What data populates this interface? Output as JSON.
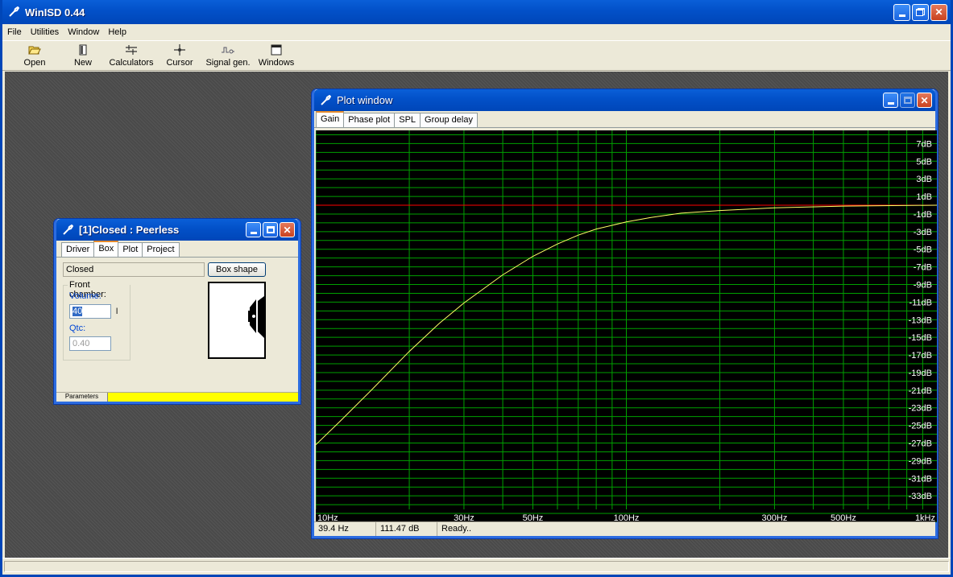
{
  "app": {
    "title": "WinISD 0.44",
    "menu": [
      "File",
      "Utilities",
      "Window",
      "Help"
    ],
    "toolbar": [
      {
        "label": "Open",
        "icon": "open-folder-icon"
      },
      {
        "label": "New",
        "icon": "new-document-icon"
      },
      {
        "label": "Calculators",
        "icon": "calculator-icon"
      },
      {
        "label": "Cursor",
        "icon": "cursor-icon"
      },
      {
        "label": "Signal gen.",
        "icon": "signal-generator-icon"
      },
      {
        "label": "Windows",
        "icon": "windows-icon"
      }
    ]
  },
  "box_window": {
    "title": "[1]Closed : Peerless",
    "tabs": [
      "Driver",
      "Box",
      "Plot",
      "Project"
    ],
    "active_tab": "Box",
    "box_type": "Closed",
    "box_shape_button": "Box shape",
    "front_chamber_label": "Front chamber:",
    "volume_label": "Volume:",
    "volume_value": "40",
    "volume_unit": "l",
    "qtc_label": "Qtc:",
    "qtc_value": "0.40",
    "bottom_tab": "Parameters"
  },
  "plot_window": {
    "title": "Plot window",
    "tabs": [
      "Gain",
      "Phase plot",
      "SPL",
      "Group delay"
    ],
    "active_tab": "Gain",
    "status": {
      "frequency": "39.4 Hz",
      "level": "111.47 dB",
      "message": "Ready.."
    }
  },
  "colors": {
    "curve": "#ffff66",
    "reference_line": "#ff0000",
    "grid": "#00a000",
    "axis_text": "#ffffff",
    "plot_background": "#000000"
  },
  "chart_data": {
    "type": "line",
    "title": "",
    "xlabel": "",
    "ylabel": "",
    "xscale": "log",
    "xlim": [
      10,
      1000
    ],
    "ylim": [
      -35,
      9
    ],
    "x_ticks": [
      {
        "value": 10,
        "label": "10Hz"
      },
      {
        "value": 30,
        "label": "30Hz"
      },
      {
        "value": 50,
        "label": "50Hz"
      },
      {
        "value": 100,
        "label": "100Hz"
      },
      {
        "value": 300,
        "label": "300Hz"
      },
      {
        "value": 500,
        "label": "500Hz"
      },
      {
        "value": 1000,
        "label": "1kHz"
      }
    ],
    "y_ticks": [
      {
        "value": 7,
        "label": "7dB"
      },
      {
        "value": 5,
        "label": "5dB"
      },
      {
        "value": 3,
        "label": "3dB"
      },
      {
        "value": 1,
        "label": "1dB"
      },
      {
        "value": -1,
        "label": "-1dB"
      },
      {
        "value": -3,
        "label": "-3dB"
      },
      {
        "value": -5,
        "label": "-5dB"
      },
      {
        "value": -7,
        "label": "-7dB"
      },
      {
        "value": -9,
        "label": "-9dB"
      },
      {
        "value": -11,
        "label": "-11dB"
      },
      {
        "value": -13,
        "label": "-13dB"
      },
      {
        "value": -15,
        "label": "-15dB"
      },
      {
        "value": -17,
        "label": "-17dB"
      },
      {
        "value": -19,
        "label": "-19dB"
      },
      {
        "value": -21,
        "label": "-21dB"
      },
      {
        "value": -23,
        "label": "-23dB"
      },
      {
        "value": -25,
        "label": "-25dB"
      },
      {
        "value": -27,
        "label": "-27dB"
      },
      {
        "value": -29,
        "label": "-29dB"
      },
      {
        "value": -31,
        "label": "-31dB"
      },
      {
        "value": -33,
        "label": "-33dB"
      }
    ],
    "reference_level": 0,
    "grid": true,
    "series": [
      {
        "x": [
          10,
          12,
          15,
          20,
          25,
          30,
          40,
          50,
          60,
          70,
          80,
          100,
          120,
          150,
          200,
          300,
          500,
          1000
        ],
        "y": [
          -27.2,
          -24.5,
          -21.1,
          -16.6,
          -13.4,
          -11.1,
          -7.9,
          -5.8,
          -4.4,
          -3.4,
          -2.7,
          -1.9,
          -1.4,
          -0.9,
          -0.6,
          -0.3,
          -0.1,
          0.0
        ]
      }
    ]
  }
}
